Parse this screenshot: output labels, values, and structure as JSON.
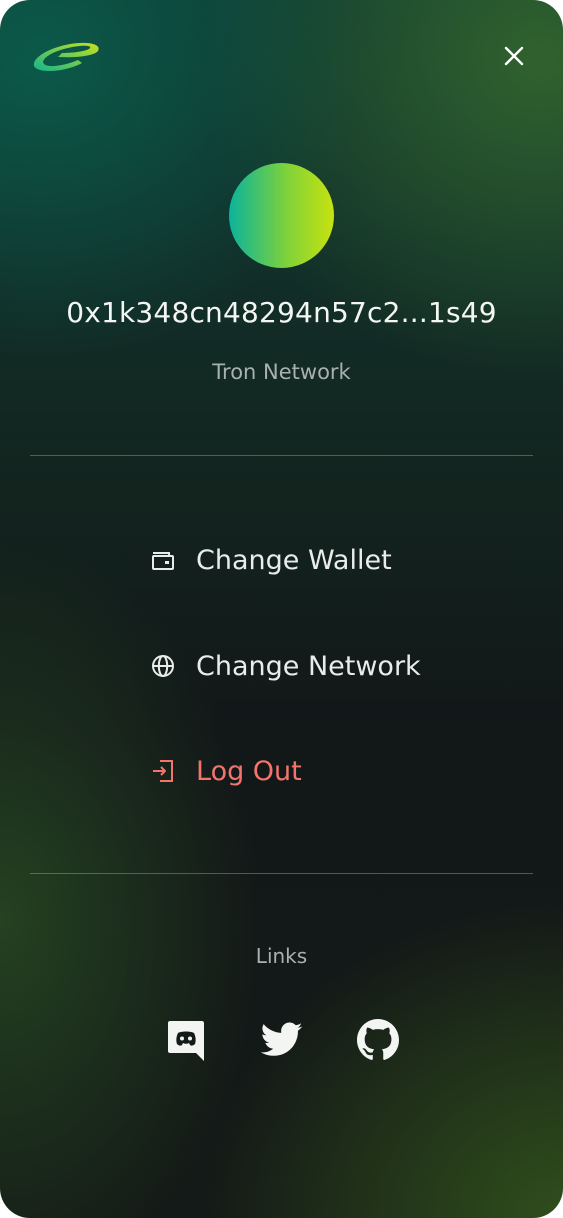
{
  "header": {
    "logo_icon": "brand-logo",
    "close_icon": "close-icon"
  },
  "account": {
    "address": "0x1k348cn48294n57c2...1s49",
    "network": "Tron Network",
    "avatar_gradient": [
      "#0bb39c",
      "#c8e20f"
    ]
  },
  "menu": [
    {
      "label": "Change Wallet",
      "icon": "wallet-icon"
    },
    {
      "label": "Change Network",
      "icon": "globe-icon"
    },
    {
      "label": "Log Out",
      "icon": "logout-icon",
      "color": "#f2746c"
    }
  ],
  "links": {
    "title": "Links",
    "items": [
      {
        "icon": "discord-icon"
      },
      {
        "icon": "twitter-icon"
      },
      {
        "icon": "github-icon"
      }
    ]
  }
}
